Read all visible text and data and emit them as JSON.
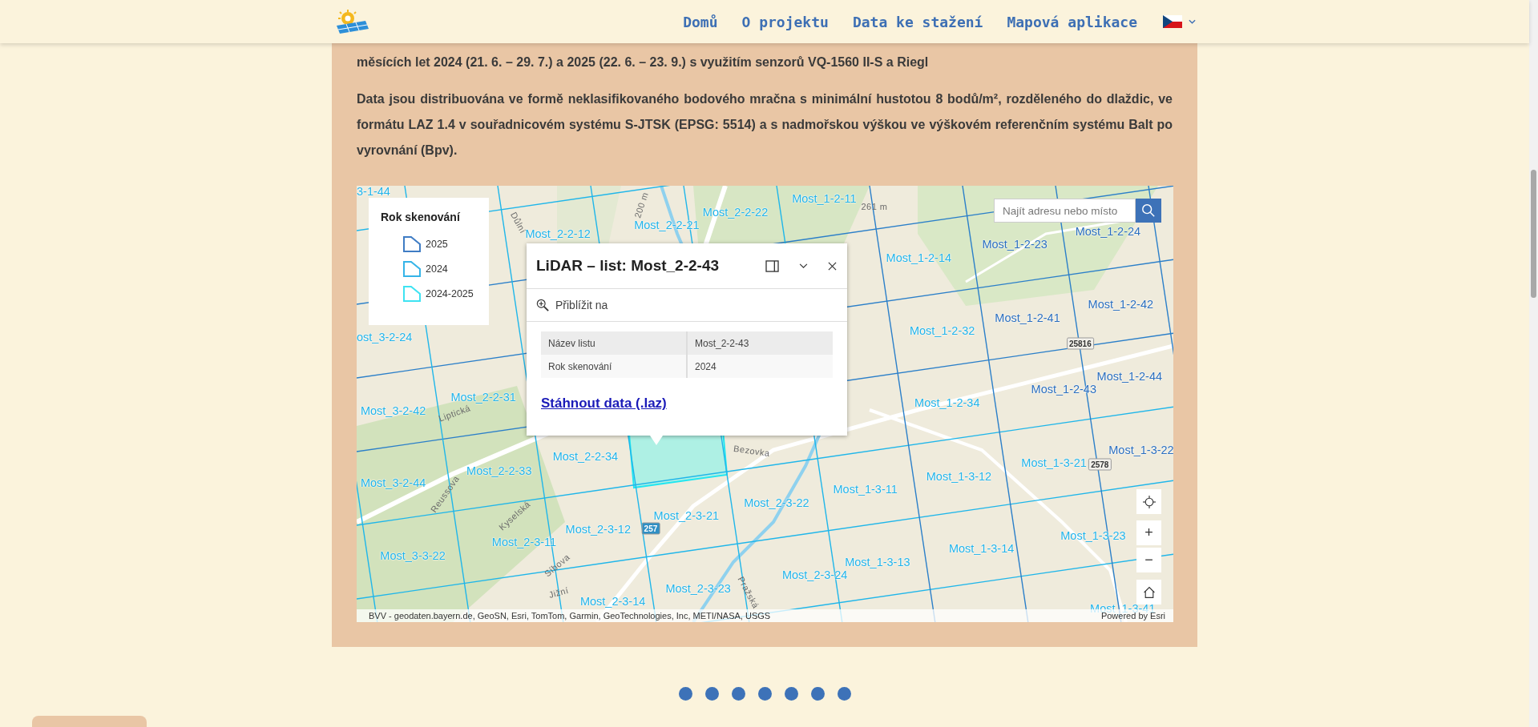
{
  "header": {
    "nav": [
      {
        "label": "Domů"
      },
      {
        "label": "O projektu"
      },
      {
        "label": "Data ke stažení"
      },
      {
        "label": "Mapová aplikace"
      }
    ]
  },
  "paragraphs": [
    "měsících let 2024 (21. 6. – 29. 7.) a 2025 (22. 6. – 23. 9.) s využitím senzorů VQ-1560 II-S a Riegl",
    "Data jsou distribuována ve formě neklasifikovaného bodového mračna s minimální hustotou 8 bodů/m², rozděleného do dlaždic, ve formátu LAZ 1.4 v souřadnicovém systému S-JTSK (EPSG: 5514) a s nadmořskou výškou ve výškovém referenčním systému Balt po vyrovnání (Bpv)."
  ],
  "map": {
    "legend": {
      "title": "Rok skenování",
      "items": [
        {
          "label": "2025",
          "color": "#3f7cc4"
        },
        {
          "label": "2024",
          "color": "#35b4e8"
        },
        {
          "label": "2024-2025",
          "color": "#3ee3f2"
        }
      ]
    },
    "search": {
      "placeholder": "Najít adresu nebo místo"
    },
    "tile_labels": [
      {
        "text": "3-1-44",
        "color": "#22b4ea"
      },
      {
        "text": "Most_1-2-11",
        "color": "#22b4ea"
      },
      {
        "text": "Most_2-2-22",
        "color": "#22b4ea"
      },
      {
        "text": "Most_2-2-21",
        "color": "#22b4ea"
      },
      {
        "text": "Most_2-2-12",
        "color": "#22b4ea"
      },
      {
        "text": "Most_1-2-24",
        "color": "#2b6fbf"
      },
      {
        "text": "Most_1-2-23",
        "color": "#2b6fbf"
      },
      {
        "text": "Most_1-2-14",
        "color": "#22b4ea"
      },
      {
        "text": "ost_3-2-24",
        "color": "#22b4ea"
      },
      {
        "text": "Most_1-2-42",
        "color": "#2b6fbf"
      },
      {
        "text": "Most_1-2-41",
        "color": "#2b6fbf"
      },
      {
        "text": "Most_1-2-32",
        "color": "#22b4ea"
      },
      {
        "text": "Most_1-2-44",
        "color": "#2b6fbf"
      },
      {
        "text": "Most_1-2-43",
        "color": "#2b6fbf"
      },
      {
        "text": "Most_1-2-34",
        "color": "#22b4ea"
      },
      {
        "text": "Most_2-2-31",
        "color": "#22b4ea"
      },
      {
        "text": "Most_3-2-42",
        "color": "#22b4ea"
      },
      {
        "text": "Most_1-3-22",
        "color": "#2b6fbf"
      },
      {
        "text": "Most_1-3-21",
        "color": "#22b4ea"
      },
      {
        "text": "Most_1-3-12",
        "color": "#22b4ea"
      },
      {
        "text": "Most_1-3-11",
        "color": "#22b4ea"
      },
      {
        "text": "Most_2-2-34",
        "color": "#22b4ea"
      },
      {
        "text": "Most_2-2-33",
        "color": "#22b4ea"
      },
      {
        "text": "Most_3-2-44",
        "color": "#22b4ea"
      },
      {
        "text": "Most_2-3-22",
        "color": "#22b4ea"
      },
      {
        "text": "Most_2-3-21",
        "color": "#22b4ea"
      },
      {
        "text": "Most_2-3-12",
        "color": "#22b4ea"
      },
      {
        "text": "Most_2-3-11",
        "color": "#22b4ea"
      },
      {
        "text": "Most_3-3-22",
        "color": "#22b4ea"
      },
      {
        "text": "Most_1-3-23",
        "color": "#22b4ea"
      },
      {
        "text": "Most_1-3-14",
        "color": "#22b4ea"
      },
      {
        "text": "Most_1-3-13",
        "color": "#22b4ea"
      },
      {
        "text": "Most_2-3-24",
        "color": "#22b4ea"
      },
      {
        "text": "Most_2-3-23",
        "color": "#22b4ea"
      },
      {
        "text": "Most_2-3-14",
        "color": "#22b4ea"
      },
      {
        "text": "Most_1-3-41",
        "color": "#22b4ea"
      }
    ],
    "street_labels": [
      "Důlní",
      "200 m",
      "261 m",
      "Liptická",
      "Reussova",
      "Kyselská",
      "Síbova",
      "Jižní",
      "Bezovka",
      "Pražská"
    ],
    "road_numbers": [
      {
        "text": "25816",
        "color": "#f2f0ea"
      },
      {
        "text": "2578",
        "color": "#f2f0ea"
      },
      {
        "text": "257",
        "color": "#2f8fc4"
      }
    ],
    "zoom_in": "+",
    "zoom_out": "−",
    "attribution": "BVV - geodaten.bayern.de, GeoSN, Esri, TomTom, Garmin, GeoTechnologies, Inc, METI/NASA, USGS",
    "powered_by": "Powered by Esri",
    "popup": {
      "title": "LiDAR – list: Most_2-2-43",
      "action": "Přiblížit na",
      "fields": [
        {
          "label": "Název listu",
          "value": "Most_2-2-43"
        },
        {
          "label": "Rok skenování",
          "value": "2024"
        }
      ],
      "link": "Stáhnout data (.laz)"
    }
  },
  "carousel_dots": [
    {
      "selected": false
    },
    {
      "selected": false
    },
    {
      "selected": false
    },
    {
      "selected": false
    },
    {
      "selected": false
    },
    {
      "selected": false
    },
    {
      "selected": false
    }
  ]
}
